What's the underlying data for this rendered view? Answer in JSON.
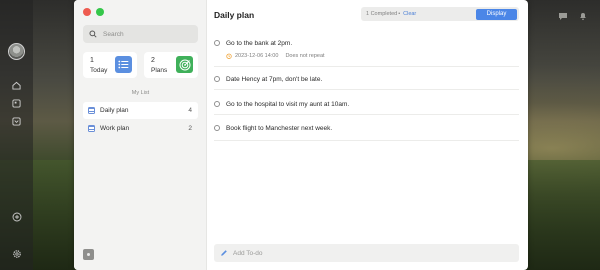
{
  "sidebar": {
    "search_placeholder": "Search",
    "cards": [
      {
        "count": "1",
        "label": "Today",
        "icon": "list-icon",
        "color": "#5b8fe0"
      },
      {
        "count": "2",
        "label": "Plans",
        "icon": "target-icon",
        "color": "#3fb05a"
      }
    ],
    "my_list_title": "My List",
    "lists": [
      {
        "name": "Daily plan",
        "count": "4",
        "active": true
      },
      {
        "name": "Work plan",
        "count": "2",
        "active": false
      }
    ]
  },
  "main": {
    "title": "Daily plan",
    "completed_label": "1 Completed",
    "dot": "•",
    "clear_label": "Clear",
    "display_label": "Display",
    "tasks": [
      {
        "text": "Go to the bank at 2pm.",
        "date": "2023-12-06 14:00",
        "repeat": "Does not repeat"
      },
      {
        "text": "Date Hency at 7pm, don't be late."
      },
      {
        "text": "Go to the hospital to visit my aunt at 10am."
      },
      {
        "text": "Book flight to Manchester next week."
      }
    ],
    "add_placeholder": "Add To-do"
  },
  "colors": {
    "accent": "#4b86e7",
    "alarm": "#f0a030"
  }
}
